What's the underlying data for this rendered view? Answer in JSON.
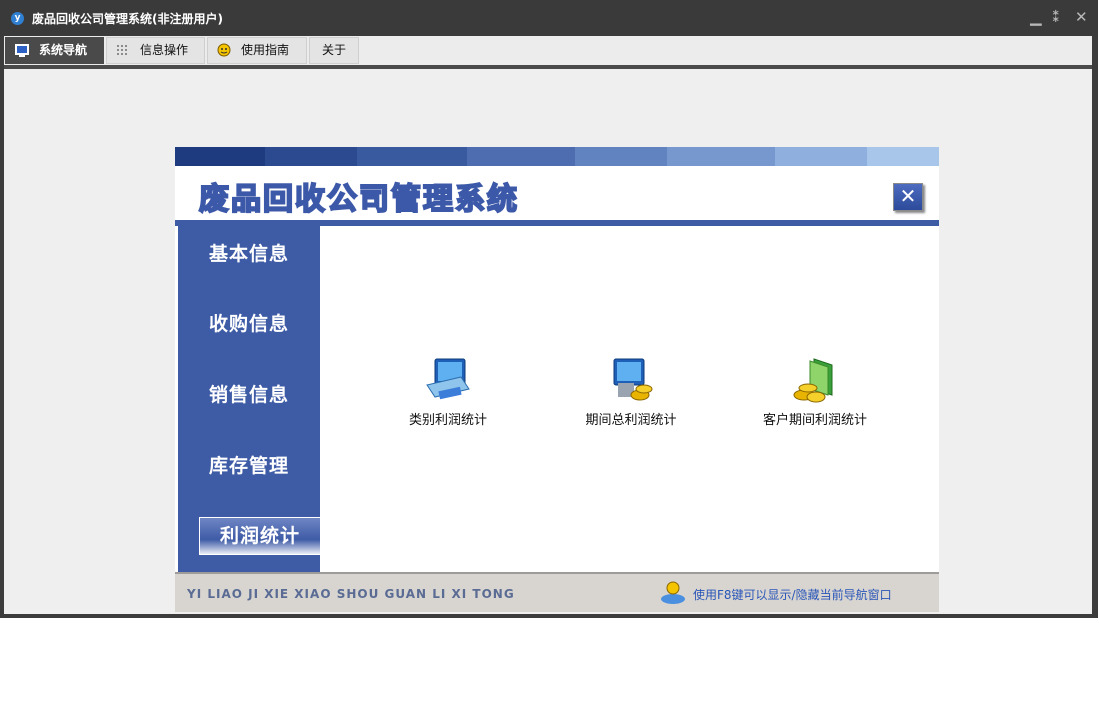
{
  "window": {
    "title": "废品回收公司管理系统(非注册用户)",
    "icon_glyph": "y",
    "controls": {
      "minimize": "▁",
      "restore": "⁑",
      "close": "✕"
    }
  },
  "tabs": [
    {
      "label": "系统导航",
      "icon": "monitor-icon",
      "active": true
    },
    {
      "label": "信息操作",
      "icon": "grid-icon",
      "active": false
    },
    {
      "label": "使用指南",
      "icon": "smiley-icon",
      "active": false
    },
    {
      "label": "关于",
      "icon": "",
      "active": false
    }
  ],
  "panel": {
    "banner_title": "废品回收公司管理系统",
    "close_glyph": "✕",
    "side_items": [
      {
        "label": "基本信息",
        "active": false
      },
      {
        "label": "收购信息",
        "active": false
      },
      {
        "label": "销售信息",
        "active": false
      },
      {
        "label": "库存管理",
        "active": false
      },
      {
        "label": "利润统计",
        "active": true
      }
    ],
    "main_items": [
      {
        "label": "类别利润统计",
        "icon": "computer-card-icon"
      },
      {
        "label": "期间总利润统计",
        "icon": "computer-coins-icon"
      },
      {
        "label": "客户期间利润统计",
        "icon": "coins-icon"
      }
    ],
    "footer_left": "YI LIAO JI XIE XIAO SHOU GUAN LI XI TONG",
    "footer_right": "使用F8键可以显示/隐藏当前导航窗口"
  },
  "colors": {
    "accent": "#3e5ba6",
    "title_bar": "#3a3a3a",
    "stripe": [
      "#1f3b7f",
      "#2c4a8f",
      "#3a5aa0",
      "#4d6db0",
      "#6183c0",
      "#7698cf",
      "#8fb0de",
      "#a8c6ea"
    ]
  }
}
